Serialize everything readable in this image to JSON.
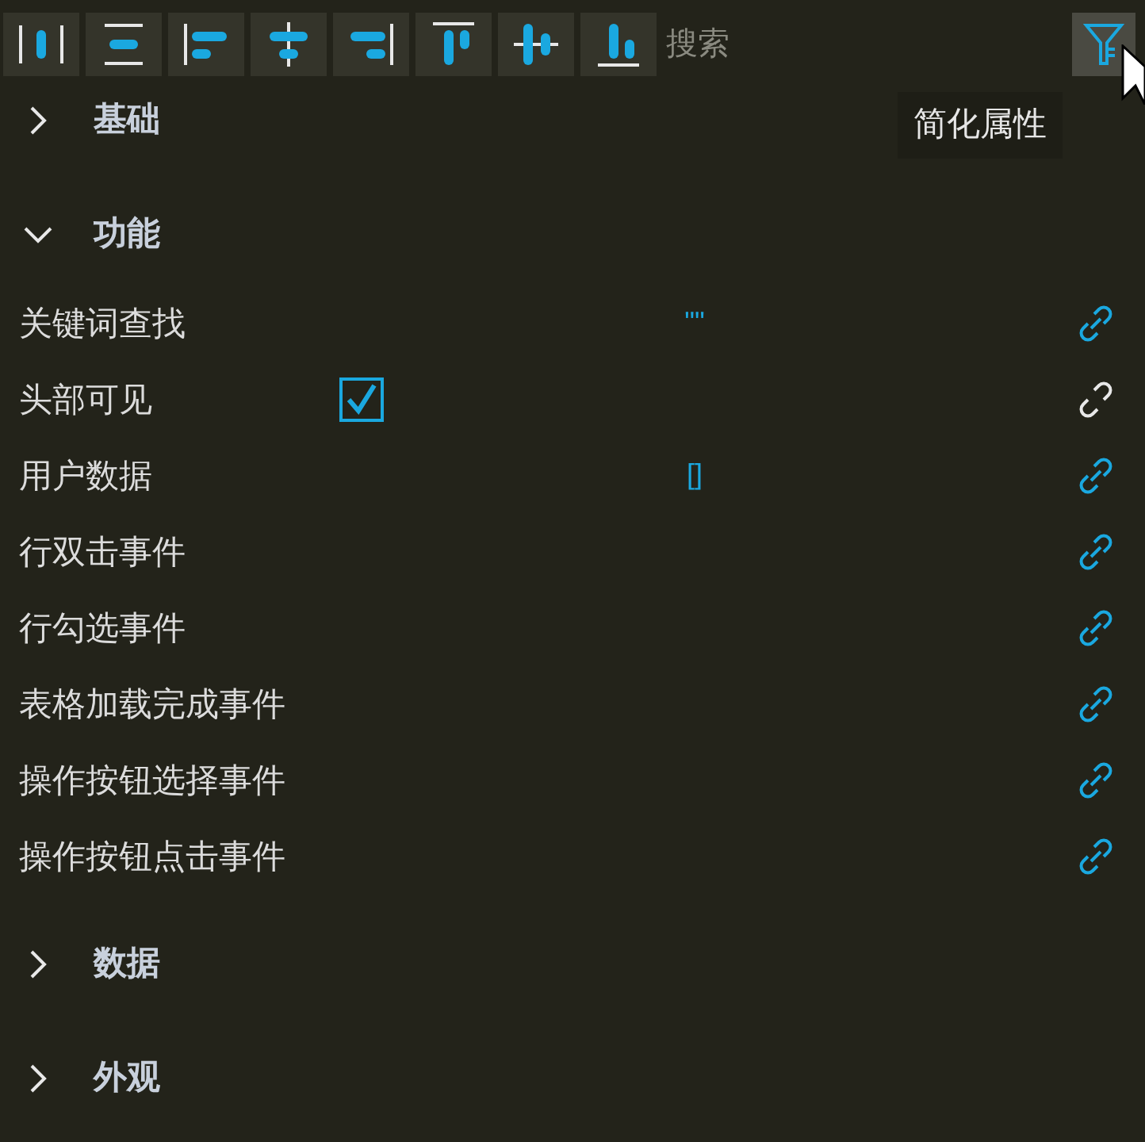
{
  "toolbar": {
    "align_buttons": [
      {
        "kind": "distribute"
      },
      {
        "kind": "middle"
      },
      {
        "kind": "left"
      },
      {
        "kind": "hcenter"
      },
      {
        "kind": "right"
      },
      {
        "kind": "top"
      },
      {
        "kind": "vcenter"
      },
      {
        "kind": "bottom"
      }
    ],
    "search": {
      "placeholder": "搜索"
    },
    "filter_button": {
      "selected": true
    },
    "tooltip": "简化属性"
  },
  "sections": [
    {
      "title": "基础",
      "expanded": false
    },
    {
      "title": "功能",
      "expanded": true,
      "rows": [
        {
          "label": "关键词查找",
          "kind": "text",
          "value": "\"\"",
          "bound": true
        },
        {
          "label": "头部可见",
          "kind": "checkbox",
          "checked": true,
          "bound": false
        },
        {
          "label": "用户数据",
          "kind": "text",
          "value": "[]",
          "bound": true
        },
        {
          "label": "行双击事件",
          "kind": "none",
          "bound": true
        },
        {
          "label": "行勾选事件",
          "kind": "none",
          "bound": true
        },
        {
          "label": "表格加载完成事件",
          "kind": "none",
          "bound": true
        },
        {
          "label": "操作按钮选择事件",
          "kind": "none",
          "bound": true
        },
        {
          "label": "操作按钮点击事件",
          "kind": "none",
          "bound": true
        }
      ]
    },
    {
      "title": "数据",
      "expanded": false
    },
    {
      "title": "外观",
      "expanded": false
    }
  ]
}
